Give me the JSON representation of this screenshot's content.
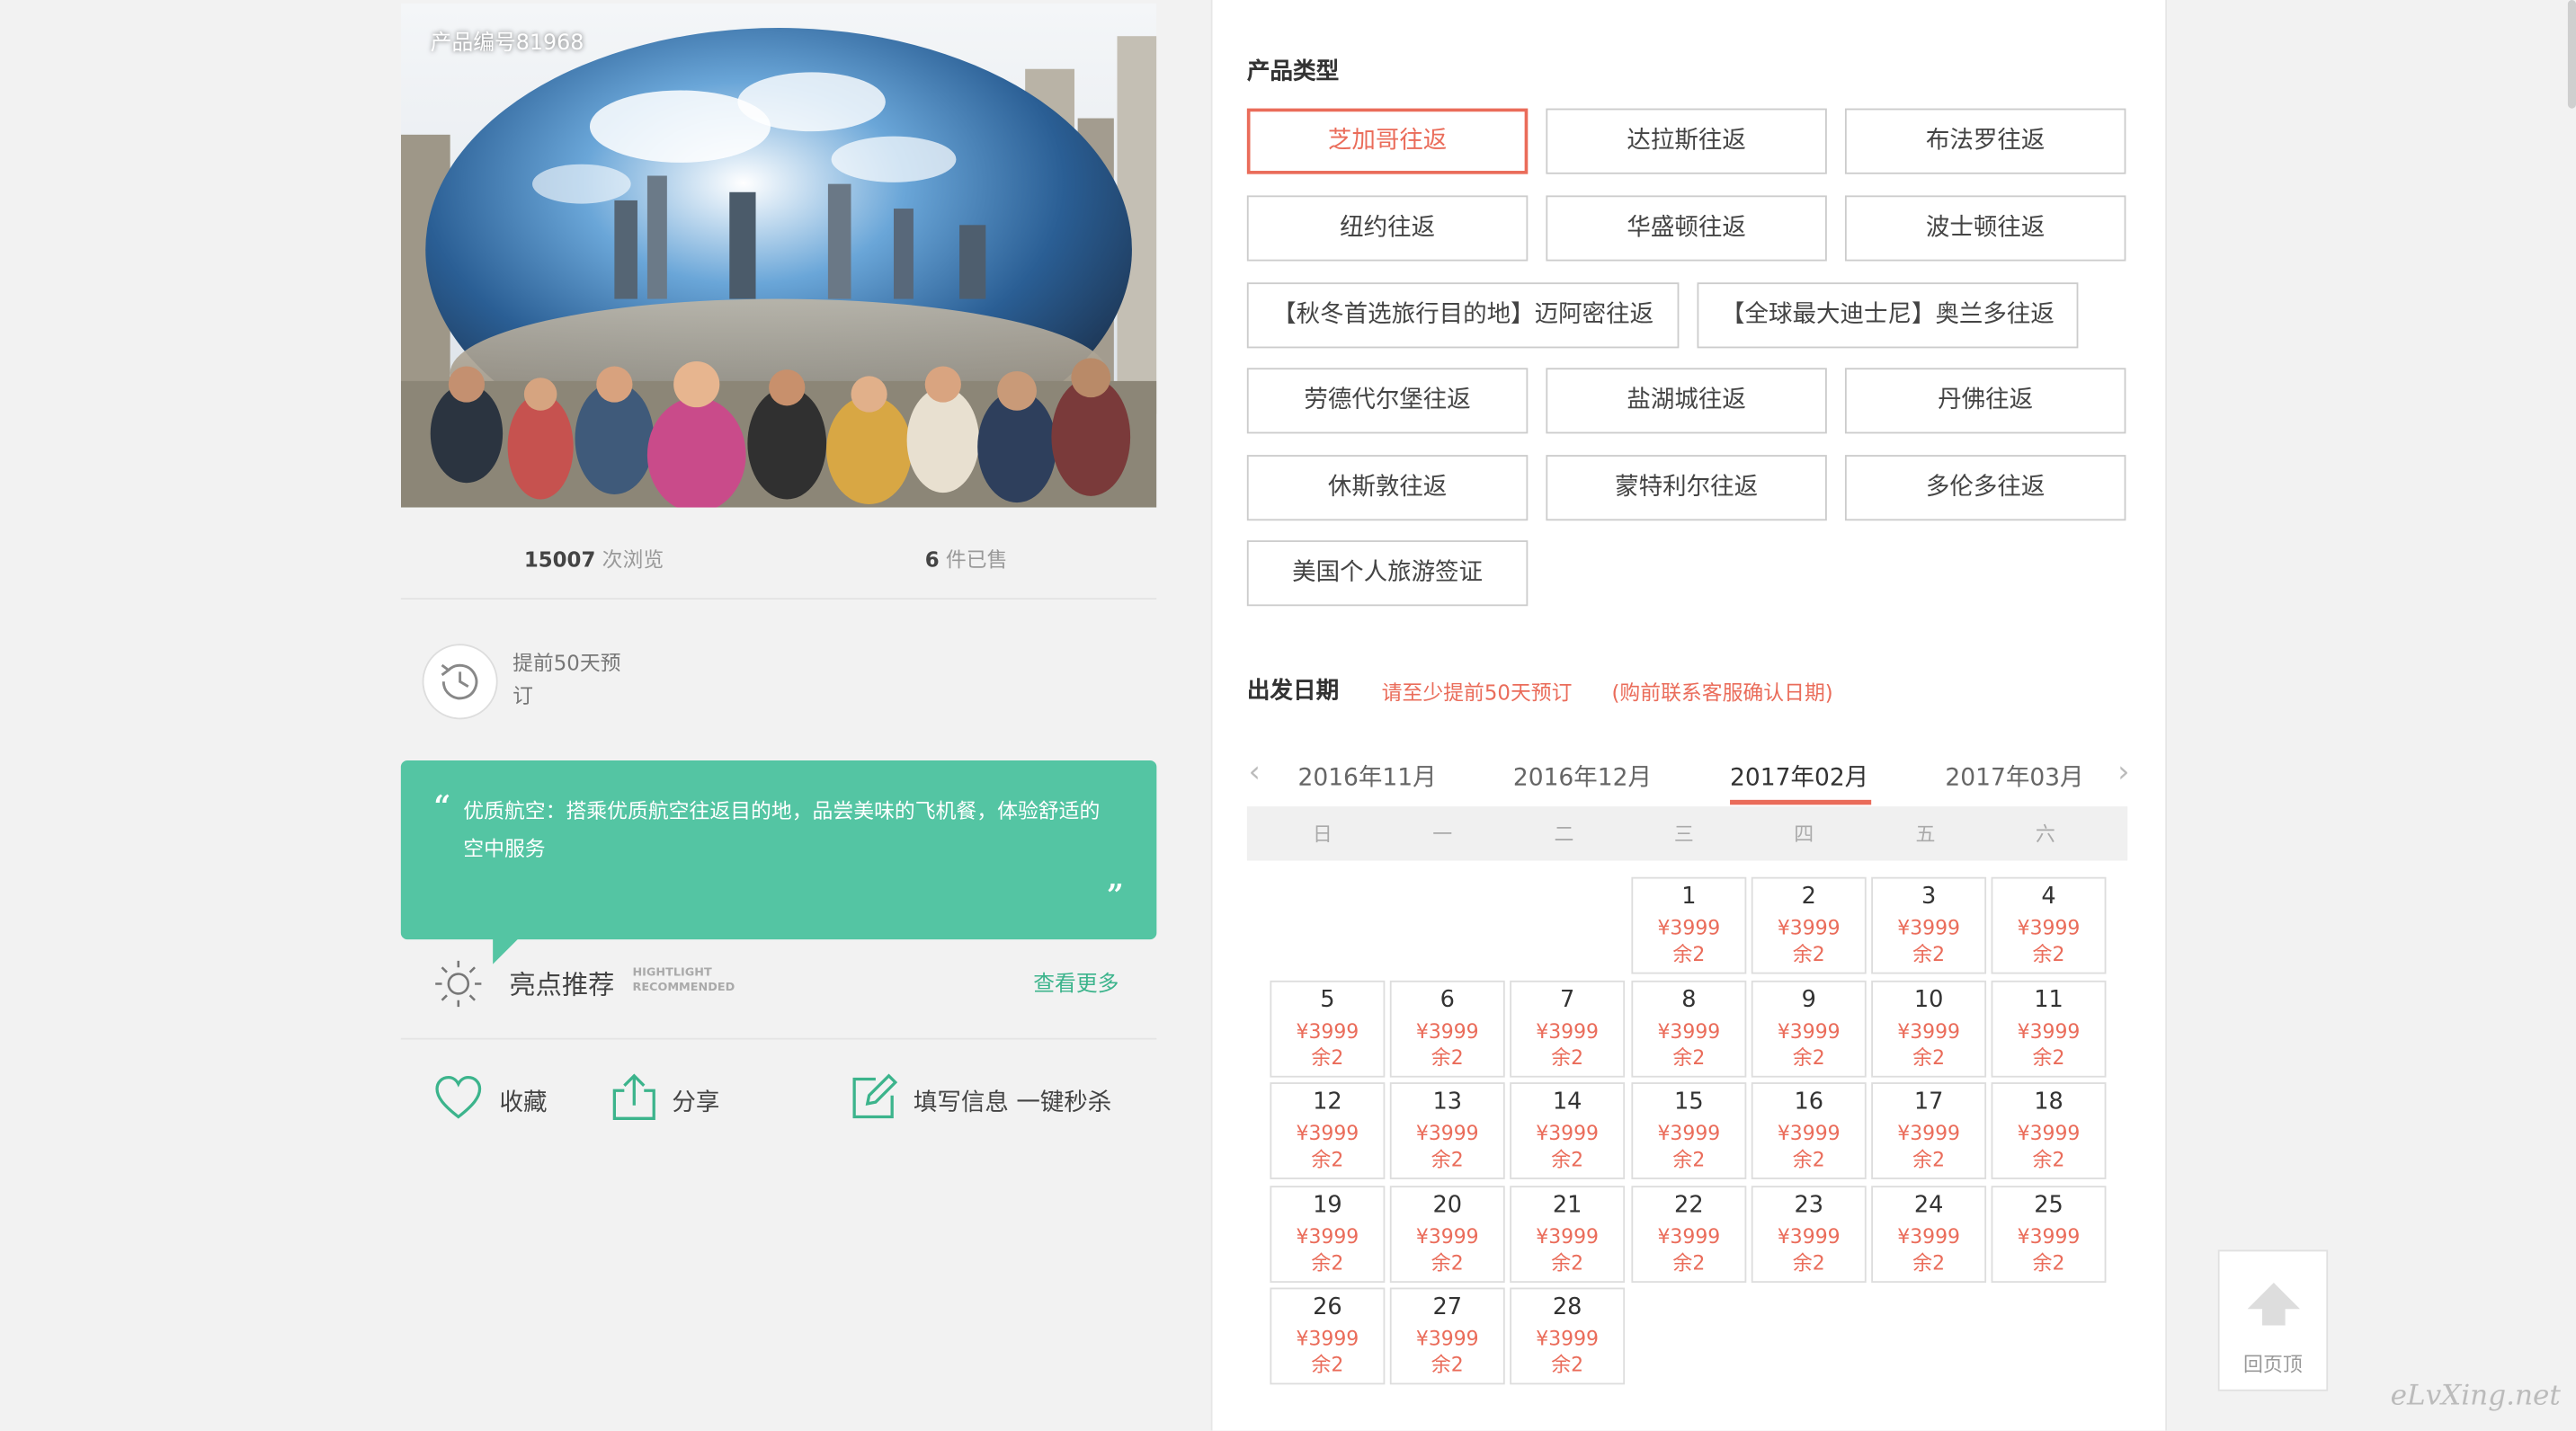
{
  "product": {
    "code_label": "产品编号81968",
    "views_count": "15007",
    "views_suffix": "次浏览",
    "sold_count": "6",
    "sold_suffix": "件已售",
    "booking_note": "提前50天预订",
    "quote_text": "优质航空：搭乘优质航空往返目的地，品尝美味的飞机餐，体验舒适的空中服务",
    "highlight_title": "亮点推荐",
    "highlight_en_1": "HIGHTLIGHT",
    "highlight_en_2": "RECOMMENDED",
    "view_more": "查看更多"
  },
  "actions": {
    "favorite": "收藏",
    "share": "分享",
    "fill_info": "填写信息 一键秒杀"
  },
  "product_types": {
    "title": "产品类型",
    "options": [
      "芝加哥往返",
      "达拉斯往返",
      "布法罗往返",
      "纽约往返",
      "华盛顿往返",
      "波士顿往返",
      "【秋冬首选旅行目的地】迈阿密往返",
      "【全球最大迪士尼】奥兰多往返",
      "劳德代尔堡往返",
      "盐湖城往返",
      "丹佛往返",
      "休斯敦往返",
      "蒙特利尔往返",
      "多伦多往返",
      "美国个人旅游签证"
    ],
    "selected": "芝加哥往返"
  },
  "departure": {
    "title": "出发日期",
    "note1": "请至少提前50天预订",
    "note2": "(购前联系客服确认日期)",
    "months": [
      "2016年11月",
      "2016年12月",
      "2017年02月",
      "2017年03月"
    ],
    "active_month": "2017年02月",
    "weekdays": [
      "日",
      "一",
      "二",
      "三",
      "四",
      "五",
      "六"
    ],
    "first_weekday": 3,
    "days": 28,
    "price": "¥3999",
    "remain": "余2"
  },
  "back_to_top": "回页顶",
  "watermark": "eLvXing.net",
  "colors": {
    "accent": "#ea6c5a",
    "green": "#54c5a3",
    "link_green": "#3cb48c"
  }
}
